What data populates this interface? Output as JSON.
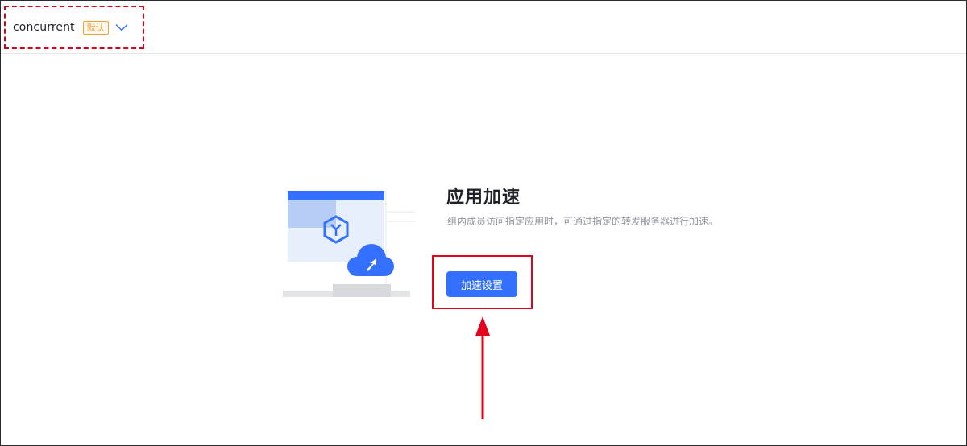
{
  "header": {
    "group_name": "concurrent",
    "default_badge": "默认",
    "chevron_icon": "chevron-down-icon"
  },
  "main": {
    "title": "应用加速",
    "description": "组内成员访问指定应用时，可通过指定的转发服务器进行加速。",
    "button_label": "加速设置",
    "illustration": "app-acceleration-illustration"
  },
  "colors": {
    "primary": "#3370ff",
    "annotation_red": "#e5001c",
    "badge_orange": "#f0a13a",
    "text_secondary": "#8f959e"
  }
}
